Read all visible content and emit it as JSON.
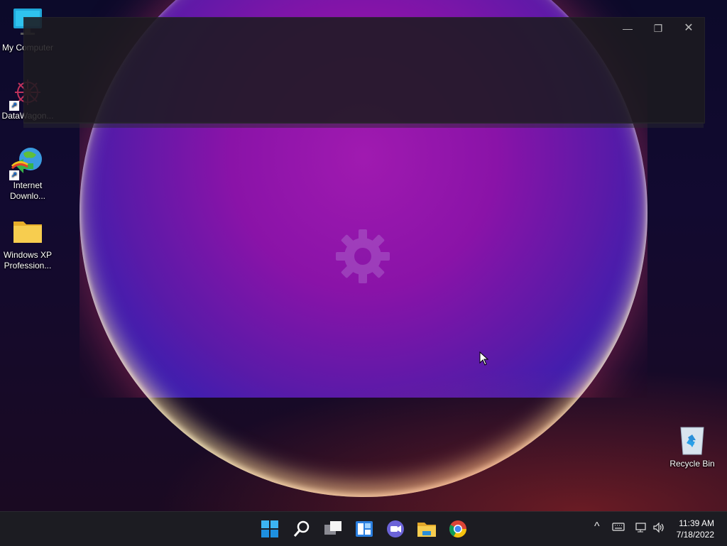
{
  "desktop": {
    "icons": [
      {
        "label": "My Computer"
      },
      {
        "label": "DataWagon..."
      },
      {
        "label_line1": "Internet",
        "label_line2": "Downlo..."
      },
      {
        "label_line1": "Windows XP",
        "label_line2": "Profession..."
      },
      {
        "label": "Recycle Bin"
      }
    ]
  },
  "window": {
    "minimize": "—",
    "maximize": "❐",
    "close": "✕"
  },
  "taskbar": {
    "apps": [
      {
        "name": "start-icon"
      },
      {
        "name": "search-icon"
      },
      {
        "name": "task-view-icon"
      },
      {
        "name": "widgets-icon"
      },
      {
        "name": "teams-chat-icon"
      },
      {
        "name": "file-explorer-icon"
      },
      {
        "name": "chrome-icon"
      }
    ],
    "tray": {
      "chevron": "^",
      "time": "11:39 AM",
      "date": "7/18/2022"
    }
  },
  "colors": {
    "taskbar_bg": "#1c1c22",
    "accent_blue": "#2aa7f0",
    "folder_yellow": "#f5c342"
  }
}
